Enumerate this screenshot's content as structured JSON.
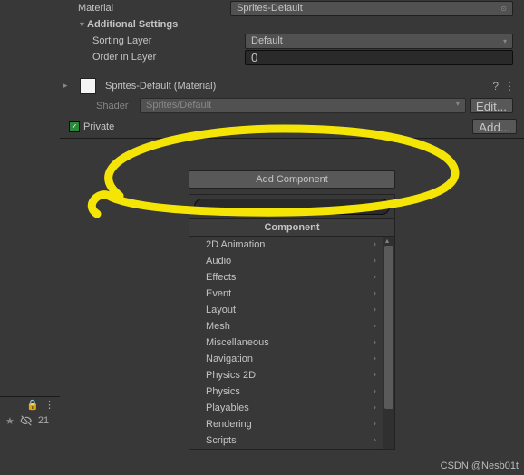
{
  "top": {
    "material_label": "Material",
    "material_value": "Sprites-Default",
    "additional_label": "Additional Settings",
    "sorting_label": "Sorting Layer",
    "sorting_value": "Default",
    "order_label": "Order in Layer",
    "order_value": "0"
  },
  "mat": {
    "title": "Sprites-Default (Material)",
    "shader_label": "Shader",
    "shader_value": "Sprites/Default",
    "edit_label": "Edit...",
    "help_icon": "?",
    "menu_icon": "⋮"
  },
  "priv": {
    "label": "Private",
    "checked": true,
    "add_label": "Add..."
  },
  "add_component_label": "Add Component",
  "menu": {
    "search_placeholder": "",
    "header": "Component",
    "items": [
      "2D Animation",
      "Audio",
      "Effects",
      "Event",
      "Layout",
      "Mesh",
      "Miscellaneous",
      "Navigation",
      "Physics 2D",
      "Physics",
      "Playables",
      "Rendering",
      "Scripts"
    ]
  },
  "leftbar": {
    "lock_icon": "lock",
    "menu_icon": "⋮",
    "eye_off": "eye-off",
    "count": "21"
  },
  "watermark": "CSDN @Nesb01t"
}
